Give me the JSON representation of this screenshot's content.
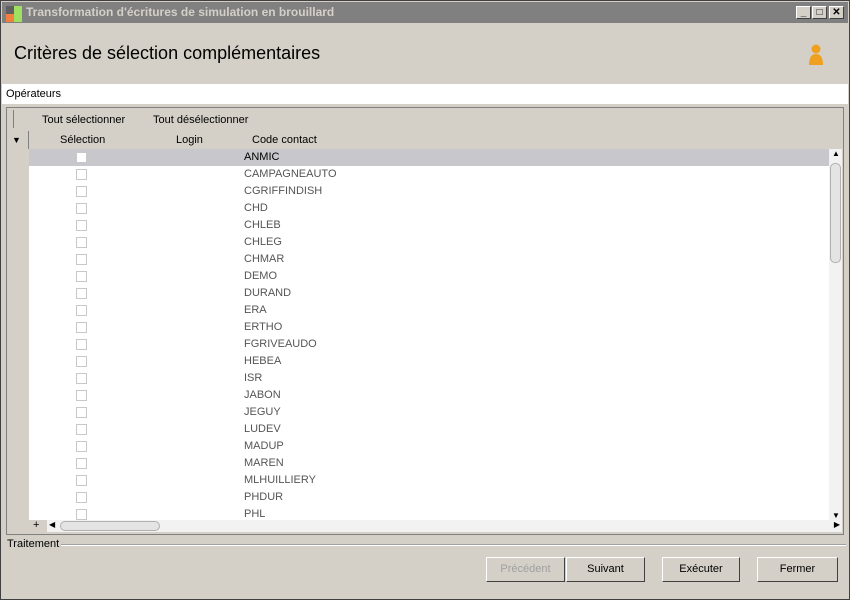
{
  "window": {
    "title": "Transformation d'écritures de simulation en brouillard",
    "minimize": "_",
    "maximize": "□",
    "close": "✕"
  },
  "header": {
    "title": "Critères de sélection complémentaires"
  },
  "section": {
    "label": "Opérateurs"
  },
  "toolbar": {
    "select_all": "Tout sélectionner",
    "deselect_all": "Tout désélectionner"
  },
  "columns": [
    "Sélection",
    "Login",
    "Code contact"
  ],
  "rows": [
    {
      "code": "ANMIC",
      "selected": false,
      "current": true
    },
    {
      "code": "CAMPAGNEAUTO",
      "selected": false
    },
    {
      "code": "CGRIFFINDISH",
      "selected": false
    },
    {
      "code": "CHD",
      "selected": false
    },
    {
      "code": "CHLEB",
      "selected": false
    },
    {
      "code": "CHLEG",
      "selected": false
    },
    {
      "code": "CHMAR",
      "selected": false
    },
    {
      "code": "DEMO",
      "selected": false
    },
    {
      "code": "DURAND",
      "selected": false
    },
    {
      "code": "ERA",
      "selected": false
    },
    {
      "code": "ERTHO",
      "selected": false
    },
    {
      "code": "FGRIVEAUDO",
      "selected": false
    },
    {
      "code": "HEBEA",
      "selected": false
    },
    {
      "code": "ISR",
      "selected": false
    },
    {
      "code": "JABON",
      "selected": false
    },
    {
      "code": "JEGUY",
      "selected": false
    },
    {
      "code": "LUDEV",
      "selected": false
    },
    {
      "code": "MADUP",
      "selected": false
    },
    {
      "code": "MAREN",
      "selected": false
    },
    {
      "code": "MLHUILLIERY",
      "selected": false
    },
    {
      "code": "PHDUR",
      "selected": false
    },
    {
      "code": "PHL",
      "selected": false
    }
  ],
  "grid_footer": {
    "add": "+"
  },
  "processing": {
    "label": "Traitement"
  },
  "buttons": {
    "previous": "Précédent",
    "next": "Suivant",
    "execute": "Exécuter",
    "close": "Fermer"
  }
}
